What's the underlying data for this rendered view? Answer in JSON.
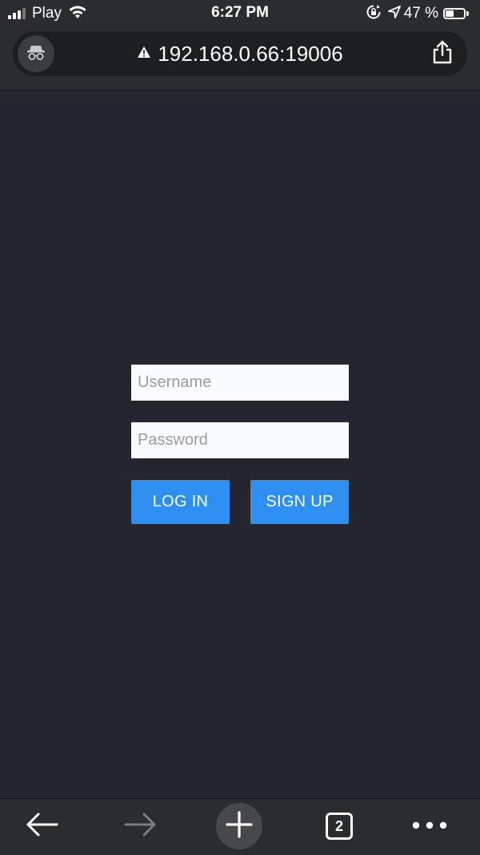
{
  "status_bar": {
    "carrier": "Play",
    "time": "6:27 PM",
    "battery_text": "47 %",
    "battery_level": 0.47
  },
  "browser": {
    "url": "192.168.0.66:19006",
    "tab_count": "2"
  },
  "login": {
    "username_placeholder": "Username",
    "password_placeholder": "Password",
    "login_label": "LOG IN",
    "signup_label": "SIGN UP"
  },
  "icons": {
    "incognito": "incognito-icon",
    "warning": "warning-icon",
    "share": "share-icon",
    "back": "back-arrow-icon",
    "forward": "forward-arrow-icon",
    "new_tab": "plus-icon",
    "menu": "more-dots-icon"
  },
  "colors": {
    "background": "#23262f",
    "chrome": "#2b2c30",
    "button": "#2d8fef",
    "input_bg": "#fafbff"
  }
}
